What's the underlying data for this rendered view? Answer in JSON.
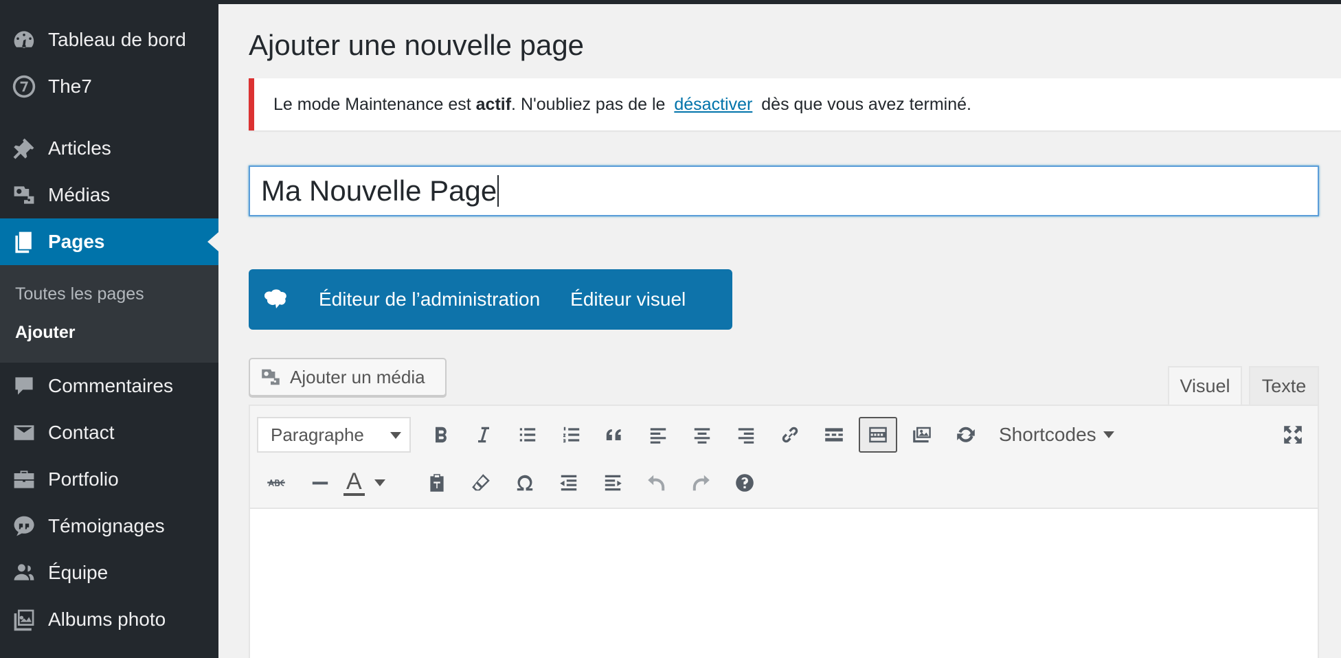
{
  "sidebar": {
    "items": [
      {
        "label": "Tableau de bord",
        "icon": "dashboard-icon"
      },
      {
        "label": "The7",
        "icon": "the7-icon"
      },
      {
        "label": "Articles",
        "icon": "pin-icon"
      },
      {
        "label": "Médias",
        "icon": "media-icon"
      },
      {
        "label": "Pages",
        "icon": "pages-icon"
      },
      {
        "label": "Commentaires",
        "icon": "comment-icon"
      },
      {
        "label": "Contact",
        "icon": "email-icon"
      },
      {
        "label": "Portfolio",
        "icon": "portfolio-icon"
      },
      {
        "label": "Témoignages",
        "icon": "testimonial-icon"
      },
      {
        "label": "Équipe",
        "icon": "team-icon"
      },
      {
        "label": "Albums photo",
        "icon": "album-icon"
      }
    ],
    "current": "Pages",
    "submenu": [
      "Toutes les pages",
      "Ajouter"
    ],
    "submenu_active": "Ajouter"
  },
  "page": {
    "title": "Ajouter une nouvelle page"
  },
  "notice": {
    "text_before": "Le mode Maintenance est ",
    "bold": "actif",
    "text_middle": ". N'oubliez pas de le ",
    "link": "désactiver",
    "text_after": " dès que vous avez terminé."
  },
  "title_input": {
    "value": "Ma Nouvelle Page"
  },
  "builder": {
    "admin_label": "Éditeur de l’administration",
    "visual_label": "Éditeur visuel"
  },
  "editor": {
    "add_media_label": "Ajouter un média",
    "tabs": {
      "visuel": "Visuel",
      "texte": "Texte"
    },
    "format_select": "Paragraphe",
    "shortcodes_label": "Shortcodes",
    "active_tab": "Visuel"
  },
  "colors": {
    "sidebar_bg": "#23282d",
    "accent": "#0073aa",
    "notice_border": "#dc3232"
  }
}
